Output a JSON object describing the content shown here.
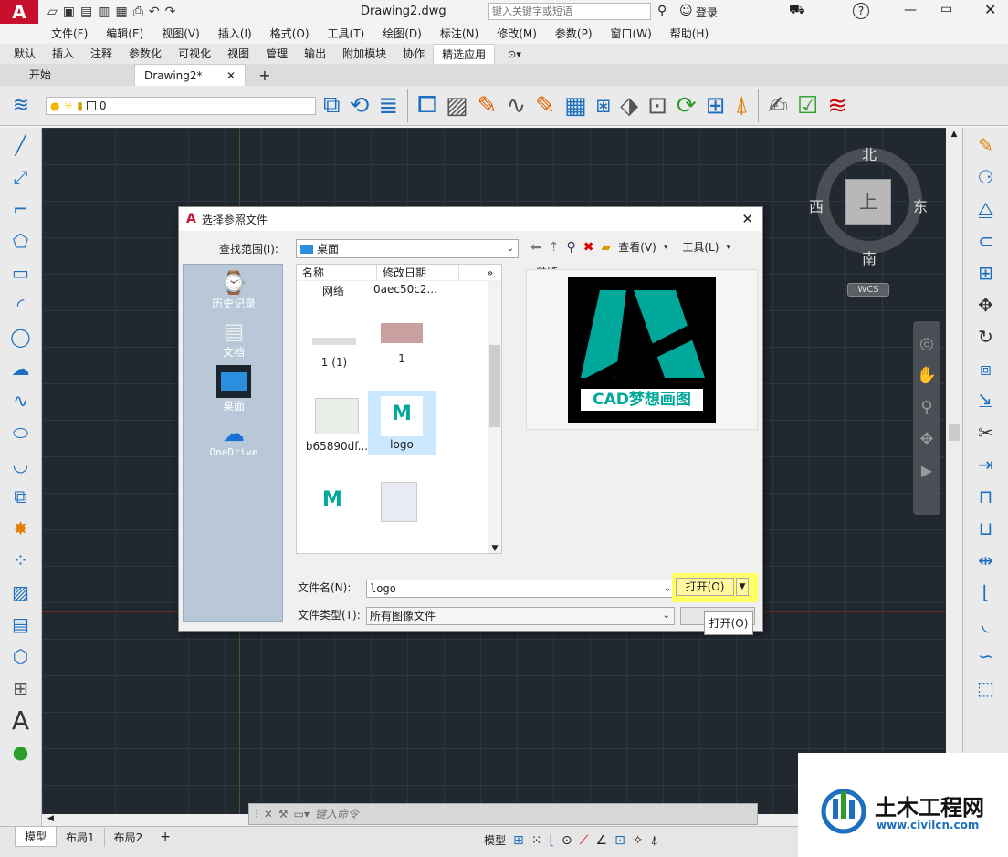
{
  "window": {
    "title": "Drawing2.dwg",
    "search_placeholder": "键入关键字或短语",
    "login": "登录"
  },
  "menu": [
    "文件(F)",
    "编辑(E)",
    "视图(V)",
    "插入(I)",
    "格式(O)",
    "工具(T)",
    "绘图(D)",
    "标注(N)",
    "修改(M)",
    "参数(P)",
    "窗口(W)",
    "帮助(H)"
  ],
  "ribbon_tabs": [
    "默认",
    "插入",
    "注释",
    "参数化",
    "可视化",
    "视图",
    "管理",
    "输出",
    "附加模块",
    "协作",
    "精选应用"
  ],
  "doc_tabs": {
    "start": "开始",
    "drawing": "Drawing2*"
  },
  "layer": {
    "name": "0"
  },
  "viewcube": {
    "north": "北",
    "south": "南",
    "east": "东",
    "west": "西",
    "top": "上",
    "wcs": "WCS"
  },
  "dialog": {
    "title": "选择参照文件",
    "lookin_label": "查找范围(I):",
    "lookin_value": "桌面",
    "view_label": "查看(V)",
    "tools_label": "工具(L)",
    "preview_label": "预览",
    "columns": {
      "name": "名称",
      "date": "修改日期"
    },
    "places": [
      "历史记录",
      "文档",
      "桌面",
      "OneDrive"
    ],
    "files": [
      {
        "name": "网络",
        "date": "0aec50c2..."
      },
      {
        "name": "1 (1)"
      },
      {
        "name": "1"
      },
      {
        "name": "b65890df..."
      },
      {
        "name": "logo"
      }
    ],
    "filename_label": "文件名(N):",
    "filename_value": "logo",
    "filetype_label": "文件类型(T):",
    "filetype_value": "所有图像文件",
    "open_button": "打开(O)",
    "tooltip": "打开(O)",
    "preview_text": "CAD梦想画图"
  },
  "command": {
    "placeholder": "键入命令"
  },
  "layout_tabs": [
    "模型",
    "布局1",
    "布局2"
  ],
  "status": {
    "model": "模型"
  },
  "watermark": {
    "name": "土木工程网",
    "url": "www.civilcn.com"
  },
  "colors": {
    "accent": "#c8102e",
    "selection": "#cce8ff",
    "highlight": "#ffff66",
    "teal": "#00a89c"
  }
}
